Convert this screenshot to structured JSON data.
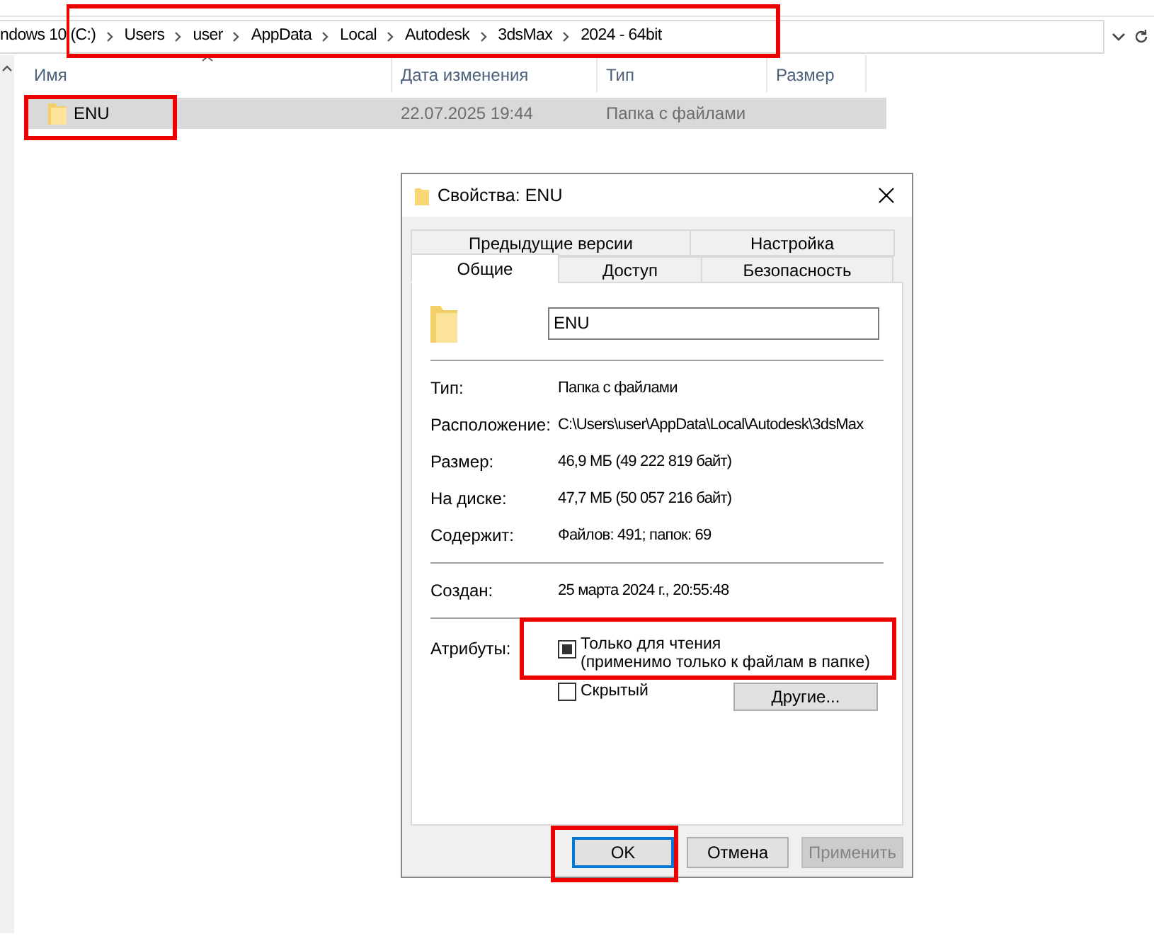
{
  "address_bar": {
    "segments": [
      "ndows 10 (C:)",
      "Users",
      "user",
      "AppData",
      "Local",
      "Autodesk",
      "3dsMax",
      "2024 - 64bit"
    ]
  },
  "file_list": {
    "columns": [
      {
        "label": "Имя",
        "sorted": true
      },
      {
        "label": "Дата изменения",
        "sorted": false
      },
      {
        "label": "Тип",
        "sorted": false
      },
      {
        "label": "Размер",
        "sorted": false
      }
    ],
    "rows": [
      {
        "name": "ENU",
        "date": "22.07.2025 19:44",
        "type": "Папка с файлами",
        "selected": true
      }
    ]
  },
  "dialog": {
    "title": "Свойства: ENU",
    "tab_rows": [
      [
        {
          "label": "Предыдущие версии",
          "selected": false
        },
        {
          "label": "Настройка",
          "selected": false
        }
      ],
      [
        {
          "label": "Общие",
          "selected": true
        },
        {
          "label": "Доступ",
          "selected": false
        },
        {
          "label": "Безопасность",
          "selected": false
        }
      ]
    ],
    "name_field": {
      "value": "ENU"
    },
    "groups": [
      [
        {
          "label": "Тип:",
          "value": "Папка с файлами"
        },
        {
          "label": "Расположение:",
          "value": "C:\\Users\\user\\AppData\\Local\\Autodesk\\3dsMax"
        },
        {
          "label": "Размер:",
          "value": "46,9 МБ (49 222 819 байт)"
        },
        {
          "label": "На диске:",
          "value": "47,7 МБ (50 057 216 байт)"
        },
        {
          "label": "Содержит:",
          "value": "Файлов: 491; папок: 69"
        }
      ],
      [
        {
          "label": "Создан:",
          "value": "25 марта 2024 г., 20:55:48"
        }
      ]
    ],
    "attributes": {
      "label": "Атрибуты:",
      "options": [
        {
          "label": "Только для чтения\n(применимо только к файлам в папке)",
          "checked": true
        },
        {
          "label": "Скрытый",
          "checked": false
        }
      ],
      "advanced_button": "Другие..."
    },
    "buttons": [
      {
        "label": "OK",
        "default": true,
        "disabled": false
      },
      {
        "label": "Отмена",
        "default": false,
        "disabled": false
      },
      {
        "label": "Применить",
        "default": false,
        "disabled": true
      }
    ]
  }
}
